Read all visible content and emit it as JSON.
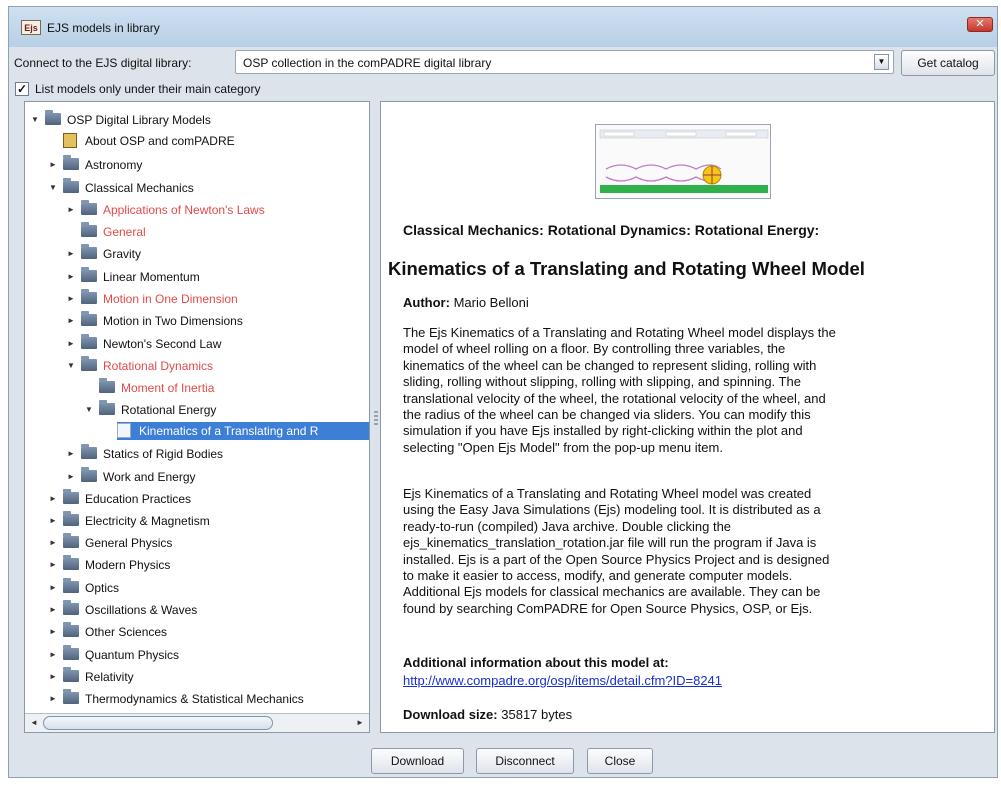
{
  "window": {
    "title": "EJS models in library",
    "app_icon": "Ejs"
  },
  "connect": {
    "label": "Connect to the EJS digital library:",
    "selected": "OSP collection in the comPADRE digital library",
    "catalog_button": "Get catalog"
  },
  "filter": {
    "checked": true,
    "label": "List models only under their main category"
  },
  "tree": {
    "root": "OSP Digital Library Models",
    "about": "About OSP and comPADRE",
    "astronomy": "Astronomy",
    "classical": "Classical Mechanics",
    "applications": "Applications of Newton's Laws",
    "general": "General",
    "gravity": "Gravity",
    "linear_momentum": "Linear Momentum",
    "motion_one": "Motion in One Dimension",
    "motion_two": "Motion in Two Dimensions",
    "newton_second": "Newton's Second Law",
    "rotational_dynamics": "Rotational Dynamics",
    "moment_inertia": "Moment of Inertia",
    "rotational_energy": "Rotational Energy",
    "selected_model": "Kinematics of a Translating and R",
    "statics": "Statics of Rigid Bodies",
    "work_energy": "Work and Energy",
    "education": "Education Practices",
    "electricity": "Electricity & Magnetism",
    "general_physics": "General Physics",
    "modern_physics": "Modern Physics",
    "optics": "Optics",
    "oscillations": "Oscillations & Waves",
    "other_sciences": "Other Sciences",
    "quantum": "Quantum Physics",
    "relativity": "Relativity",
    "thermo": "Thermodynamics & Statistical Mechanics"
  },
  "detail": {
    "breadcrumb": "Classical Mechanics: Rotational Dynamics: Rotational Energy:",
    "title": "Kinematics of a Translating and Rotating Wheel Model",
    "author_label": "Author:",
    "author": "Mario Belloni",
    "para1_lines": [
      "The Ejs Kinematics of a Translating and Rotating Wheel model displays the",
      "model of wheel rolling on a floor. By controlling three variables, the",
      "kinematics of the wheel can be changed to represent sliding, rolling with",
      "sliding, rolling without slipping, rolling with slipping, and spinning. The",
      "translational velocity of the wheel, the rotational velocity of the wheel, and",
      "the radius of the wheel can be changed via sliders. You can modify this",
      "simulation if you have Ejs installed by right-clicking within the plot and",
      "selecting \"Open Ejs Model\" from the pop-up menu item."
    ],
    "para2_lines": [
      "Ejs Kinematics of a Translating and Rotating Wheel model was created",
      "using the Easy Java Simulations (Ejs) modeling tool. It is distributed as a",
      "ready-to-run (compiled) Java archive. Double clicking the",
      "ejs_kinematics_translation_rotation.jar file will run the program if Java is",
      "installed. Ejs is a part of the Open Source Physics Project and is designed",
      "to make it easier to access, modify, and generate computer models.",
      "Additional Ejs models for classical mechanics are available. They can be",
      "found by searching ComPADRE for Open Source Physics, OSP, or Ejs."
    ],
    "additional_info": "Additional information about this model at:",
    "link": "http://www.compadre.org/osp/items/detail.cfm?ID=8241",
    "download_label": "Download size:",
    "download_size": "35817 bytes"
  },
  "buttons": {
    "download": "Download",
    "disconnect": "Disconnect",
    "close": "Close"
  },
  "colors": {
    "selected": "#3d7ed6",
    "link": "#1a2fd0",
    "disabled_category": "#e24a4a"
  }
}
